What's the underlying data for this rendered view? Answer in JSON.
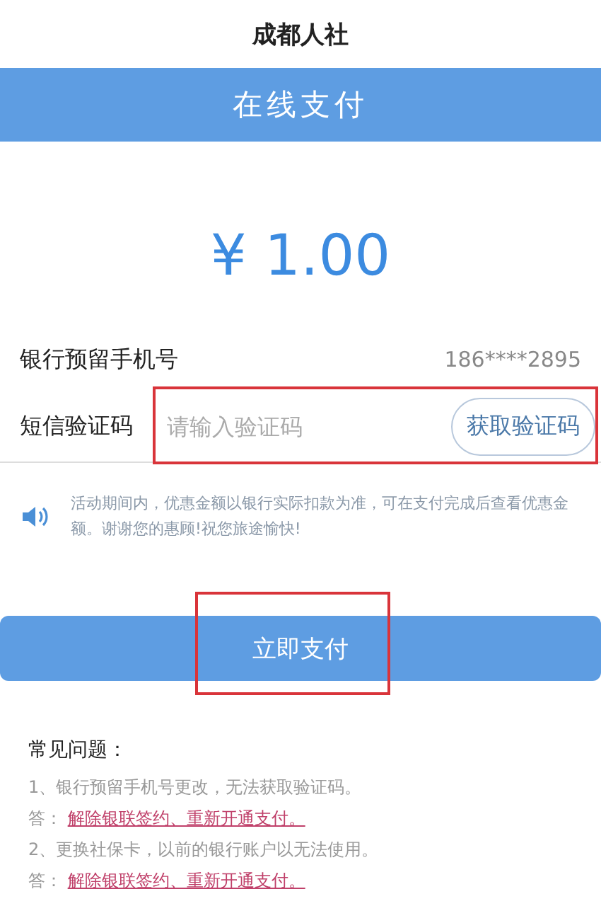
{
  "title": "成都人社",
  "banner": "在线支付",
  "amount": "¥ 1.00",
  "phone": {
    "label": "银行预留手机号",
    "value": "186****2895"
  },
  "sms": {
    "label": "短信验证码",
    "placeholder": "请输入验证码",
    "button": "获取验证码"
  },
  "notice": "活动期间内，优惠金额以银行实际扣款为准，可在支付完成后查看优惠金额。谢谢您的惠顾!祝您旅途愉快!",
  "pay_button": "立即支付",
  "faq": {
    "title": "常见问题：",
    "items": [
      {
        "question": "1、银行预留手机号更改，无法获取验证码。",
        "answer_label": "答：",
        "answer_link": "解除银联签约、重新开通支付。"
      },
      {
        "question": "2、更换社保卡，以前的银行账户以无法使用。",
        "answer_label": "答：",
        "answer_link": "解除银联签约、重新开通支付。"
      }
    ]
  }
}
